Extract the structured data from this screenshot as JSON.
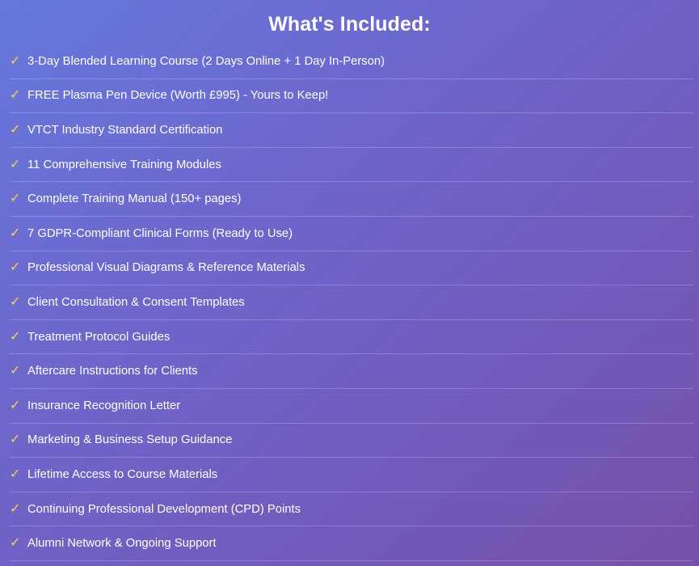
{
  "title": "What's Included:",
  "items": [
    {
      "icon": "check-icon",
      "label": "3-Day Blended Learning Course (2 Days Online + 1 Day In-Person)"
    },
    {
      "icon": "check-icon",
      "label": "FREE Plasma Pen Device (Worth £995) - Yours to Keep!"
    },
    {
      "icon": "check-icon",
      "label": "VTCT Industry Standard Certification"
    },
    {
      "icon": "check-icon",
      "label": "11 Comprehensive Training Modules"
    },
    {
      "icon": "check-icon",
      "label": "Complete Training Manual (150+ pages)"
    },
    {
      "icon": "check-icon",
      "label": "7 GDPR-Compliant Clinical Forms (Ready to Use)"
    },
    {
      "icon": "check-icon",
      "label": "Professional Visual Diagrams & Reference Materials"
    },
    {
      "icon": "check-icon",
      "label": "Client Consultation & Consent Templates"
    },
    {
      "icon": "check-icon",
      "label": "Treatment Protocol Guides"
    },
    {
      "icon": "check-icon",
      "label": "Aftercare Instructions for Clients"
    },
    {
      "icon": "check-icon",
      "label": "Insurance Recognition Letter"
    },
    {
      "icon": "check-icon",
      "label": "Marketing & Business Setup Guidance"
    },
    {
      "icon": "check-icon",
      "label": "Lifetime Access to Course Materials"
    },
    {
      "icon": "check-icon",
      "label": "Continuing Professional Development (CPD) Points"
    },
    {
      "icon": "check-icon",
      "label": "Alumni Network & Ongoing Support"
    }
  ],
  "colors": {
    "check": "#ffd43d",
    "background_start": "#6678dd",
    "background_end": "#7651aa"
  }
}
